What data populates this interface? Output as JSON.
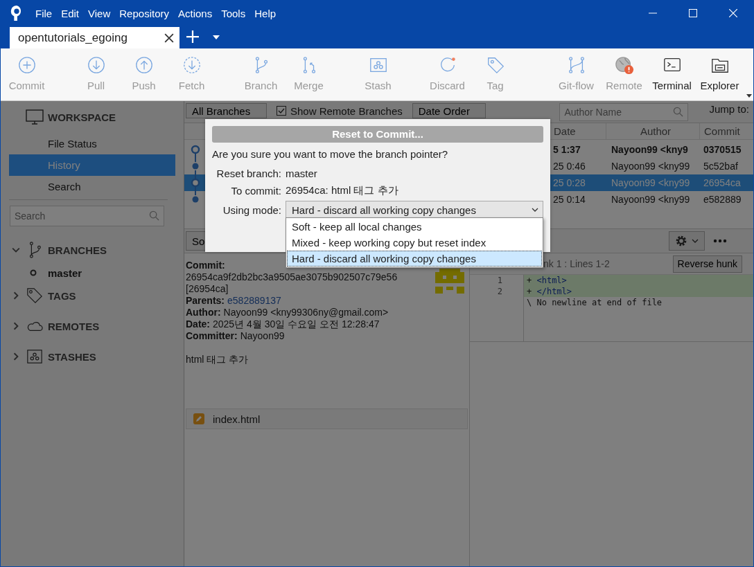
{
  "menu": [
    "File",
    "Edit",
    "View",
    "Repository",
    "Actions",
    "Tools",
    "Help"
  ],
  "tabs": [
    {
      "label": "opentutorials_egoing",
      "selected": true
    }
  ],
  "toolbar": [
    {
      "label": "Commit",
      "disabled": true
    },
    {
      "label": "Pull",
      "disabled": true
    },
    {
      "label": "Push",
      "disabled": true
    },
    {
      "label": "Fetch",
      "disabled": true
    },
    {
      "label": "Branch",
      "disabled": true
    },
    {
      "label": "Merge",
      "disabled": true
    },
    {
      "label": "Stash",
      "disabled": true
    },
    {
      "label": "Discard",
      "disabled": true
    },
    {
      "label": "Tag",
      "disabled": true
    },
    {
      "label": "Git-flow",
      "disabled": true
    },
    {
      "label": "Remote",
      "disabled": true
    },
    {
      "label": "Terminal",
      "disabled": false
    },
    {
      "label": "Explorer",
      "disabled": false
    }
  ],
  "sidebar": {
    "workspace": {
      "title": "WORKSPACE",
      "items": [
        {
          "label": "File Status",
          "selected": false
        },
        {
          "label": "History",
          "selected": true
        },
        {
          "label": "Search",
          "selected": false
        }
      ]
    },
    "search": {
      "placeholder": "Search"
    },
    "sections": [
      {
        "label": "BRANCHES",
        "expanded": true,
        "children": [
          {
            "label": "master",
            "current": true
          }
        ]
      },
      {
        "label": "TAGS",
        "expanded": false
      },
      {
        "label": "REMOTES",
        "expanded": false
      },
      {
        "label": "STASHES",
        "expanded": false
      }
    ]
  },
  "graph": {
    "filter": "All Branches",
    "show_remote": {
      "label": "Show Remote Branches",
      "checked": true
    },
    "order": "Date Order",
    "author_search": {
      "placeholder": "Author Name"
    },
    "jump_to": "Jump to:",
    "columns": [
      "Date",
      "Author",
      "Commit"
    ],
    "rows": [
      {
        "date": "5 1:37",
        "author": "Nayoon99 <kny9",
        "commit": "0370515",
        "selected": false,
        "head": true
      },
      {
        "date": "25 0:46",
        "author": "Nayoon99 <kny99",
        "commit": "5c52baf",
        "selected": false,
        "head": false
      },
      {
        "date": "25 0:28",
        "author": "Nayoon99 <kny99",
        "commit": "26954ca",
        "selected": true,
        "head": false
      },
      {
        "date": "25 0:14",
        "author": "Nayoon99 <kny99",
        "commit": "e582889",
        "selected": false,
        "head": false
      }
    ]
  },
  "details": {
    "sort": "So",
    "commit_label": "Commit:",
    "commit_hash": "26954ca9f2db2bc3a9505ae3075b902507c79e56",
    "commit_short": "[26954ca]",
    "fields": [
      {
        "label": "Parents:",
        "value": "e582889137",
        "kind": "link"
      },
      {
        "label": "Author:",
        "value": "Nayoon99 <kny99306ny@gmail.com>",
        "kind": "text"
      },
      {
        "label": "Date:",
        "value": "2025년 4월 30일 수요일 오전 12:28:47",
        "kind": "text"
      },
      {
        "label": "Committer:",
        "value": "Nayoon99",
        "kind": "text"
      }
    ],
    "message": "html 태그 추가",
    "files": [
      {
        "name": "index.html"
      }
    ]
  },
  "diff": {
    "hunk": "nk 1 : Lines 1-2",
    "reverse": "Reverse hunk",
    "lines": [
      {
        "number": "1",
        "sign": "+",
        "code": "<html>",
        "kind": "added"
      },
      {
        "number": "2",
        "sign": "+",
        "code": "</html>",
        "kind": "added"
      },
      {
        "sign": "\\",
        "code": "No newline at end of file",
        "kind": "context"
      }
    ]
  },
  "dialog": {
    "title": "Reset to Commit...",
    "question": "Are you sure you want to move the branch pointer?",
    "fields": [
      {
        "label": "Reset branch:",
        "value": "master"
      },
      {
        "label": "To commit:",
        "value": "26954ca: html 태그 추가"
      }
    ],
    "mode_label": "Using mode:",
    "mode_value": "Hard - discard all working copy changes",
    "options": [
      {
        "label": "Soft - keep all local changes",
        "selected": false
      },
      {
        "label": "Mixed - keep working copy but reset index",
        "selected": false
      },
      {
        "label": "Hard - discard all working copy changes",
        "selected": true
      }
    ]
  }
}
